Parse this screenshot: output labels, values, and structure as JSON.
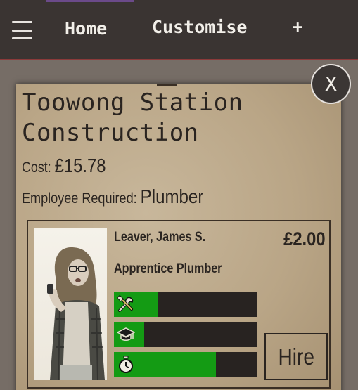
{
  "nav": {
    "menu_icon": "hamburger-icon",
    "links": [
      {
        "label": "Home"
      },
      {
        "label": "Customise"
      },
      {
        "label": "+"
      }
    ]
  },
  "close_button": {
    "label": "X"
  },
  "job": {
    "title": "Toowong Station Construction",
    "cost_label": "Cost:",
    "cost_value": "£15.78",
    "required_label": "Employee Required:",
    "required_value": "Plumber"
  },
  "employee": {
    "name": "Leaver, James S.",
    "title": "Apprentice Plumber",
    "price": "£2.00",
    "skills": [
      {
        "icon": "tools-icon",
        "level": 0.31
      },
      {
        "icon": "graduation-cap-icon",
        "level": 0.21
      },
      {
        "icon": "stopwatch-icon",
        "level": 0.71
      }
    ],
    "hire_label": "Hire"
  },
  "colors": {
    "topbar": "#3a3432",
    "skill_fill": "#149b14",
    "skill_track": "#282321",
    "card": "#b9a586"
  }
}
